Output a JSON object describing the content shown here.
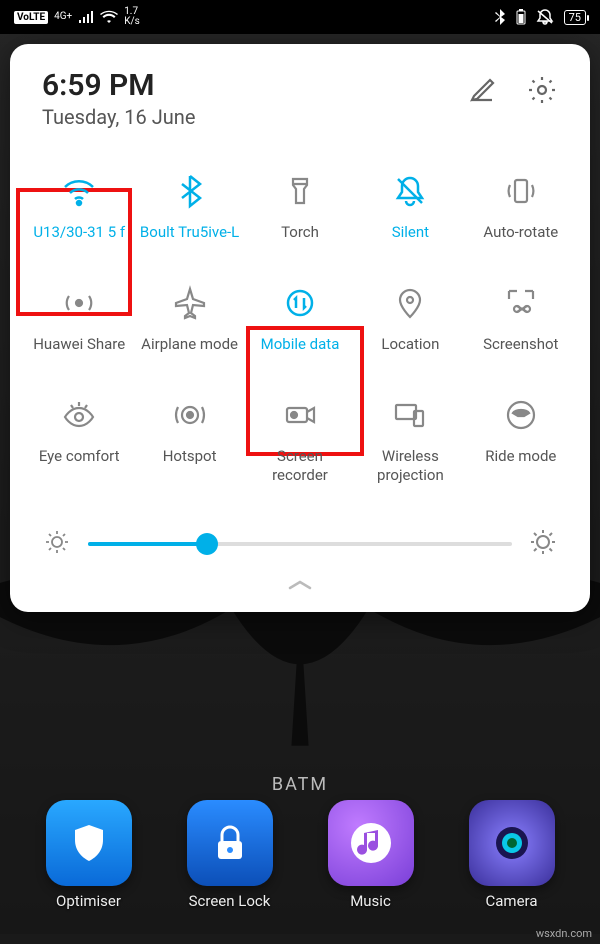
{
  "statusbar": {
    "volte": "VoLTE",
    "signal_note": "4G+",
    "speed_top": "1.7",
    "speed_unit": "K/s",
    "battery": "75"
  },
  "panel": {
    "time": "6:59 PM",
    "date": "Tuesday, 16 June",
    "brightness_percent": 28
  },
  "tiles": [
    {
      "id": "wifi",
      "label": "U13/30-31 5 f",
      "active": true
    },
    {
      "id": "bluetooth",
      "label": "Boult Tru5ive-L",
      "active": true
    },
    {
      "id": "torch",
      "label": "Torch",
      "active": false
    },
    {
      "id": "silent",
      "label": "Silent",
      "active": true
    },
    {
      "id": "autorotate",
      "label": "Auto-rotate",
      "active": false
    },
    {
      "id": "huaweishare",
      "label": "Huawei Share",
      "active": false
    },
    {
      "id": "airplane",
      "label": "Airplane mode",
      "active": false
    },
    {
      "id": "mobiledata",
      "label": "Mobile data",
      "active": true
    },
    {
      "id": "location",
      "label": "Location",
      "active": false
    },
    {
      "id": "screenshot",
      "label": "Screenshot",
      "active": false
    },
    {
      "id": "eyecomfort",
      "label": "Eye comfort",
      "active": false
    },
    {
      "id": "hotspot",
      "label": "Hotspot",
      "active": false
    },
    {
      "id": "screenrecorder",
      "label": "Screen\nrecorder",
      "active": false
    },
    {
      "id": "wirelessproj",
      "label": "Wireless\nprojection",
      "active": false
    },
    {
      "id": "ridemode",
      "label": "Ride mode",
      "active": false
    }
  ],
  "apps": [
    {
      "id": "optimiser",
      "label": "Optimiser"
    },
    {
      "id": "screenlock",
      "label": "Screen Lock"
    },
    {
      "id": "music",
      "label": "Music"
    },
    {
      "id": "camera",
      "label": "Camera"
    }
  ],
  "background_text": "BATM",
  "watermark": "wsxdn.com"
}
